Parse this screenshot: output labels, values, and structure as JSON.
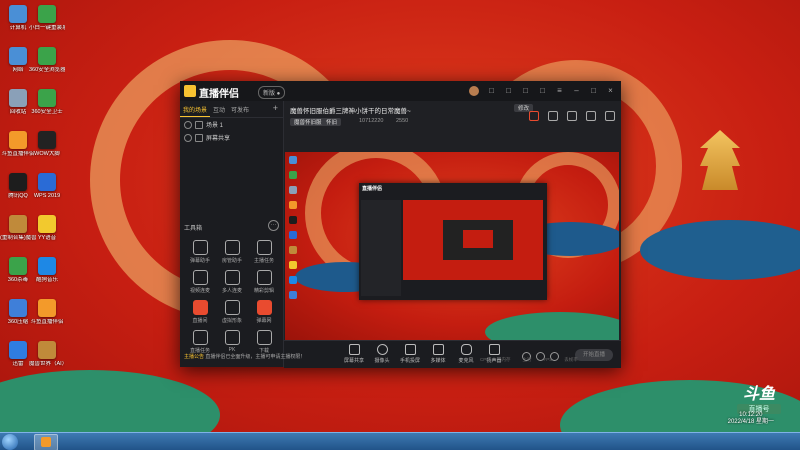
{
  "desktop": {
    "icons": [
      {
        "label": "计算机",
        "color": "#4a8fd6"
      },
      {
        "label": "小白一键重装系统",
        "color": "#3ba34a"
      },
      {
        "label": "网络",
        "color": "#4a8fd6"
      },
      {
        "label": "360安全浏览器",
        "color": "#3ba34a"
      },
      {
        "label": "回收站",
        "color": "#8aa0b8"
      },
      {
        "label": "360安全卫士",
        "color": "#3ba34a"
      },
      {
        "label": "斗鱼直播伴侣",
        "color": "#f39a2a"
      },
      {
        "label": "WOW大脚",
        "color": "#222222"
      },
      {
        "label": "腾讯QQ",
        "color": "#1d1d1d"
      },
      {
        "label": "WPS 2019",
        "color": "#2a6bd6"
      },
      {
        "label": "(重制合集)魔兽争霸III",
        "color": "#c08a3a"
      },
      {
        "label": "YY语音",
        "color": "#f2c92e"
      },
      {
        "label": "360杀毒",
        "color": "#3ba34a"
      },
      {
        "label": "酷狗音乐",
        "color": "#1e88e5"
      },
      {
        "label": "360压缩",
        "color": "#3f7fd9"
      },
      {
        "label": "斗鱼直播伴侣",
        "color": "#f39a2a"
      },
      {
        "label": "迅雷",
        "color": "#2f7de1"
      },
      {
        "label": "魔兽世界（AI）",
        "color": "#c08a3a"
      }
    ],
    "clock_time": "10:12:20",
    "clock_date": "2022/4/18 星期一",
    "watermark_logo": "斗鱼",
    "watermark_sub": "直播号"
  },
  "app": {
    "title": "直播伴侣",
    "version": "新版 ●",
    "left_tabs": [
      "我的场景",
      "互动",
      "可发布"
    ],
    "add_label": "+",
    "scenes": [
      "场景 1",
      "屏幕共享"
    ],
    "tools_heading": "工具箱",
    "tools_more": "···",
    "tools": [
      {
        "label": "弹幕助手",
        "accent": false
      },
      {
        "label": "房管助手",
        "accent": false
      },
      {
        "label": "主播任务",
        "accent": false
      },
      {
        "label": "视频连麦",
        "accent": false
      },
      {
        "label": "多人连麦",
        "accent": false
      },
      {
        "label": "精彩剪辑",
        "accent": false
      },
      {
        "label": "直播间",
        "accent": true
      },
      {
        "label": "虚拟形象",
        "accent": false
      },
      {
        "label": "弹幕网",
        "accent": true
      },
      {
        "label": "直播任务",
        "accent": false
      },
      {
        "label": "PK",
        "accent": false
      },
      {
        "label": "下载",
        "accent": false
      }
    ],
    "room_title": "魔兽怀旧服伯爵三牌神小饼干的日常魔兽~",
    "edit_label": "修改",
    "category": "魔兽怀旧服",
    "sub_category": "怀旧",
    "room_id": "10712220",
    "popularity": "2550",
    "preview_title": "直播伴侣",
    "bottom_buttons": [
      "屏幕共享",
      "摄像头",
      "手机投屏",
      "多媒体",
      "麦克风",
      "扬声器"
    ],
    "start_label": "开始直播",
    "notice_prefix": "主播公告",
    "notice_text": "直播伴侣已全面升级，主播可申请主播权限！",
    "status": [
      "CPU",
      "内存",
      "上行",
      "FPS",
      "丢帧率"
    ]
  }
}
